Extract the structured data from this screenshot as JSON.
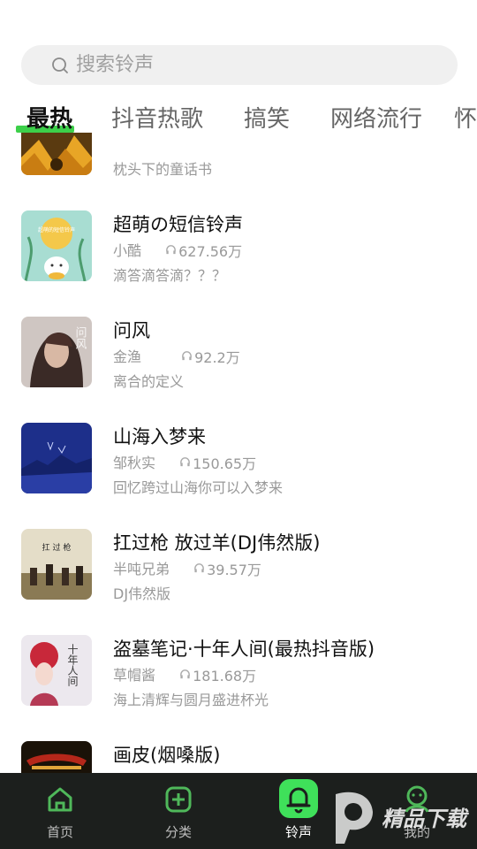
{
  "search": {
    "placeholder": "搜索铃声"
  },
  "tabs": [
    {
      "label": "最热",
      "active": true
    },
    {
      "label": "抖音热歌"
    },
    {
      "label": "搞笑"
    },
    {
      "label": "网络流行"
    },
    {
      "label": "怀"
    }
  ],
  "songs": [
    {
      "title": "",
      "artist": "",
      "plays": "",
      "desc": "枕头下的童话书"
    },
    {
      "title": "超萌の短信铃声",
      "artist": "小酷",
      "plays": "627.56万",
      "desc": "滴答滴答滴？？？"
    },
    {
      "title": "问风",
      "artist": "金渔",
      "plays": "92.2万",
      "desc": "离合的定义"
    },
    {
      "title": "山海入梦来",
      "artist": "邹秋实",
      "plays": "150.65万",
      "desc": "回忆跨过山海你可以入梦来"
    },
    {
      "title": "扛过枪 放过羊(DJ伟然版)",
      "artist": "半吨兄弟",
      "plays": "39.57万",
      "desc": "DJ伟然版"
    },
    {
      "title": "盗墓笔记·十年人间(最热抖音版)",
      "artist": "草帽酱",
      "plays": "181.68万",
      "desc": "海上清辉与圆月盛进杯光"
    },
    {
      "title": "画皮(烟嗓版)",
      "artist": "",
      "plays": "",
      "desc": ""
    }
  ],
  "thumb_text": {
    "song1": "超萌的短信铃声",
    "song2": "问风",
    "song5": "十年人间"
  },
  "bottom_nav": [
    {
      "label": "首页",
      "icon": "home-icon"
    },
    {
      "label": "分类",
      "icon": "add-square-icon"
    },
    {
      "label": "铃声",
      "icon": "bell-icon",
      "active": true
    },
    {
      "label": "我的",
      "icon": "profile-icon"
    }
  ],
  "watermark": {
    "text": "精品下载"
  },
  "colors": {
    "accent": "#3dd04a",
    "nav_bg": "#1c1f1d",
    "search_bg": "#f0f0f0"
  }
}
